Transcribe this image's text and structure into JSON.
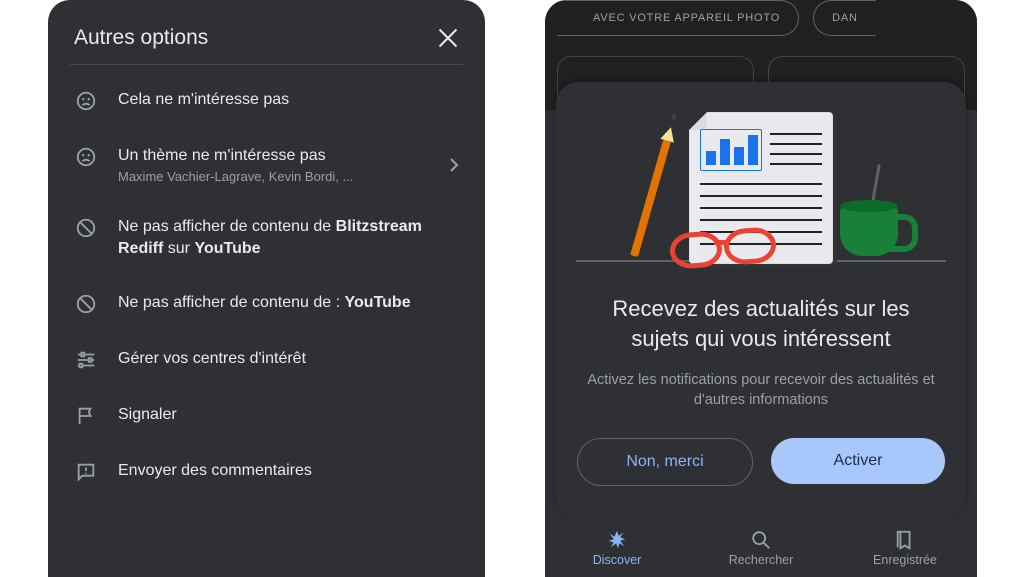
{
  "left_panel": {
    "title": "Autres options",
    "items": [
      {
        "icon": "sad-face-icon",
        "title": "Cela ne m'intéresse pas"
      },
      {
        "icon": "sad-face-icon",
        "title": "Un thème ne m'intéresse pas",
        "subtitle": "Maxime Vachier-Lagrave, Kevin Bordi, ...",
        "chevron": true
      },
      {
        "icon": "block-icon",
        "title_html": "Ne pas afficher de contenu de <b>Blitzstream Rediff</b> sur <b>YouTube</b>"
      },
      {
        "icon": "block-icon",
        "title_html": "Ne pas afficher de contenu de : <b>YouTube</b>"
      },
      {
        "icon": "tune-icon",
        "title": "Gérer vos centres d'intérêt"
      },
      {
        "icon": "flag-icon",
        "title": "Signaler"
      },
      {
        "icon": "feedback-icon",
        "title": "Envoyer des commentaires"
      }
    ]
  },
  "right_panel": {
    "chip_a": "AVEC VOTRE APPAREIL PHOTO",
    "chip_b": "DAN",
    "headline": "Recevez des actualités sur les sujets qui vous intéressent",
    "description": "Activez les notifications pour recevoir des actualités et d'autres informations",
    "btn_decline": "Non, merci",
    "btn_accept": "Activer",
    "nav": {
      "discover": "Discover",
      "search": "Rechercher",
      "saved": "Enregistrée"
    }
  }
}
